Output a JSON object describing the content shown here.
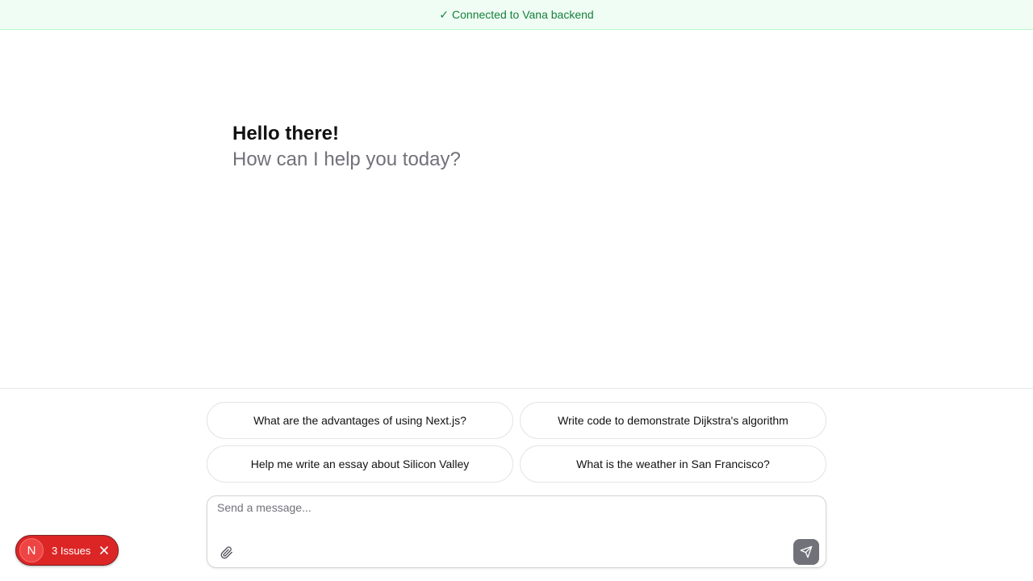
{
  "banner": {
    "check_glyph": "✓",
    "text": "Connected to Vana backend",
    "color": "#15803d"
  },
  "greeting": {
    "title": "Hello there!",
    "subtitle": "How can I help you today?"
  },
  "suggestions": [
    {
      "label": "What are the advantages of using Next.js?"
    },
    {
      "label": "Write code to demonstrate Dijkstra's algorithm"
    },
    {
      "label": "Help me write an essay about Silicon Valley"
    },
    {
      "label": "What is the weather in San Francisco?"
    }
  ],
  "composer": {
    "placeholder": "Send a message...",
    "value": "",
    "attach_icon": "paperclip-icon",
    "send_icon": "send-icon"
  },
  "devtools": {
    "logo": "N",
    "issues_label": "3 Issues",
    "close_icon": "close-icon",
    "color": "#dc2626"
  }
}
